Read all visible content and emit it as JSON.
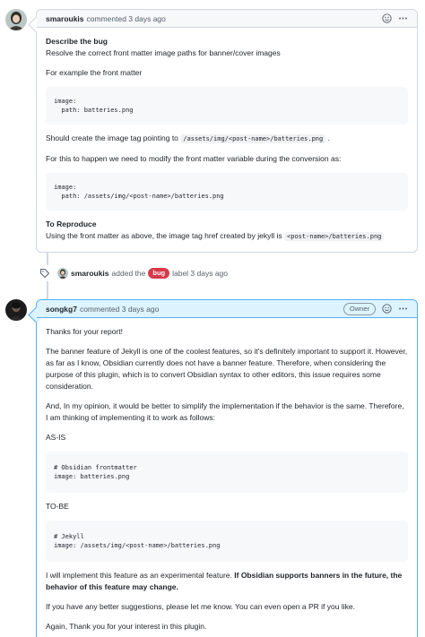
{
  "comment1": {
    "author": "smaroukis",
    "meta": "commented 3 days ago",
    "bug_heading": "Describe the bug",
    "bug_text": "Resolve the correct front matter image paths for banner/cover images",
    "example_text": "For example the front matter",
    "code1": "image:\n  path: batteries.png",
    "should_text_before": "Should create the image tag pointing to",
    "should_code": "/assets/img/<post-name>/batteries.png",
    "should_text_after": ".",
    "modify_text": "For this to happen we need to modify the front matter variable during the conversion as:",
    "code2": "image:\n  path: /assets/img/<post-name>/batteries.png",
    "repro_heading": "To Reproduce",
    "repro_text": "Using the front matter as above, the image tag href created by jekyll is",
    "repro_code": "<post-name>/batteries.png"
  },
  "event": {
    "author": "smaroukis",
    "text_before": "added the",
    "label": "bug",
    "label_color": "#d73a4a",
    "text_after": "label 3 days ago"
  },
  "comment2": {
    "author": "songkg7",
    "meta": "commented 3 days ago",
    "badge": "Owner",
    "p1": "Thanks for your report!",
    "p2": "The banner feature of Jekyll is one of the coolest features, so it's definitely important to support it. However, as far as I know, Obsidian currently does not have a banner feature. Therefore, when considering the purpose of this plugin, which is to convert Obsidian syntax to other editors, this issue requires some consideration.",
    "p3": "And, In my opinion, it would be better to simplify the implementation if the behavior is the same. Therefore, I am thinking of implementing it to work as follows:",
    "asis": "AS-IS",
    "code1": "# Obsidian frontmatter\nimage: batteries.png",
    "tobe": "TO-BE",
    "code2": "# Jekyll\nimage: /assets/img/<post-name>/batteries.png",
    "p4_plain": "I will implement this feature as an experimental feature.",
    "p4_bold": "If Obsidian supports banners in the future, the behavior of this feature may change.",
    "p5": "If you have any better suggestions, please let me know. You can even open a PR if you like.",
    "p6": "Again, Thank you for your interest in this plugin."
  },
  "icons": [
    "smiley-icon",
    "kebab-icon",
    "tag-icon"
  ],
  "colors": {
    "accent_border": "#54aeff",
    "accent_bg": "#ddf4ff",
    "border": "#d0d7de"
  }
}
